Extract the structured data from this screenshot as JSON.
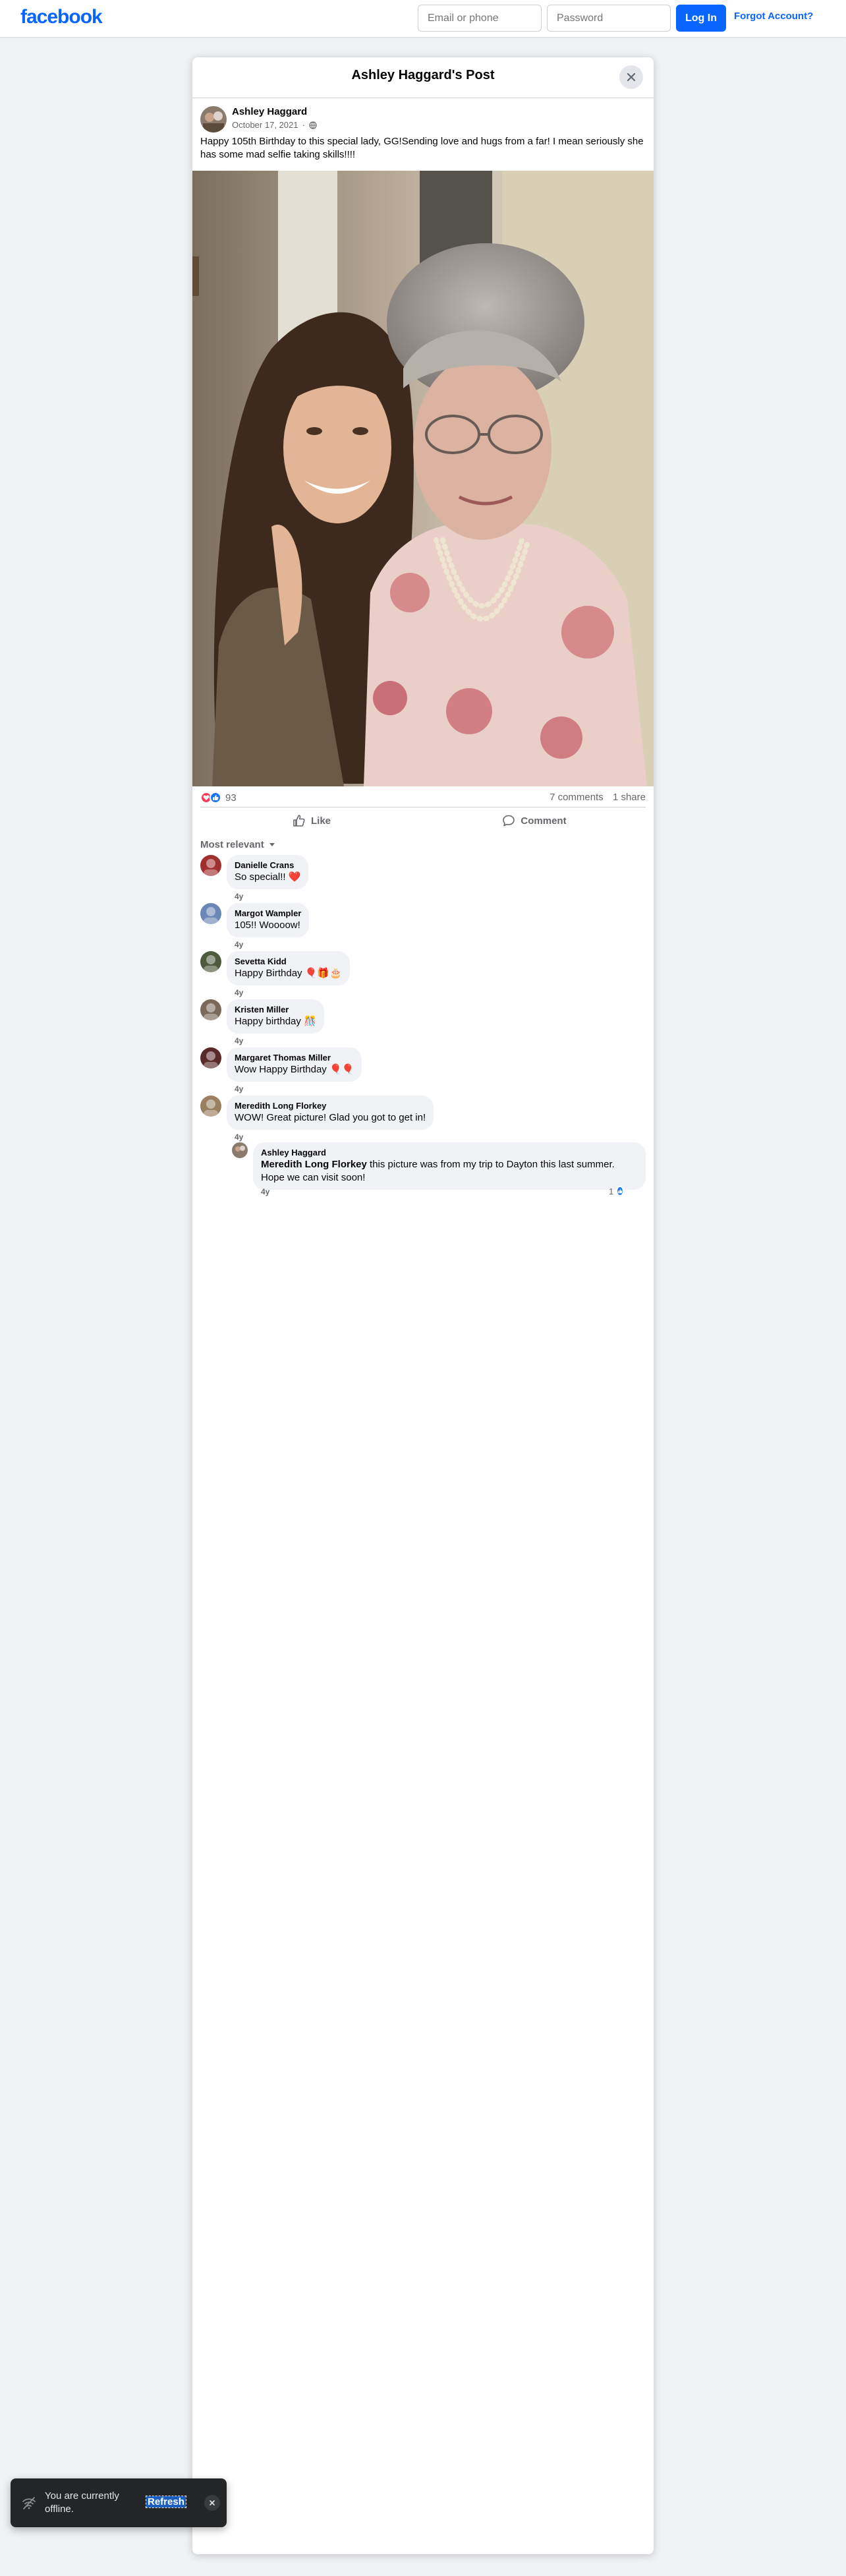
{
  "header": {
    "logo": "facebook",
    "email_placeholder": "Email or phone",
    "password_placeholder": "Password",
    "login_label": "Log In",
    "forgot_label": "Forgot Account?"
  },
  "modal": {
    "title": "Ashley Haggard's Post"
  },
  "post": {
    "author": "Ashley Haggard",
    "date": "October 17, 2021",
    "privacy_icon": "globe-icon",
    "text": "Happy 105th Birthday to this special lady, GG!Sending love and hugs from a far! I mean seriously she has some mad selfie taking skills!!!!",
    "reaction_count": "93",
    "comments_count": "7 comments",
    "shares_count": "1 share",
    "like_label": "Like",
    "comment_label": "Comment",
    "sort_label": "Most relevant"
  },
  "comments": [
    {
      "name": "Danielle Crans",
      "text": "So special!! ❤️",
      "time": "4y",
      "color": "#a0302f"
    },
    {
      "name": "Margot Wampler",
      "text": "105!! Woooow!",
      "time": "4y",
      "color": "#6a87b5"
    },
    {
      "name": "Sevetta Kidd",
      "text": "Happy Birthday 🎈🎁🎂",
      "time": "4y",
      "color": "#4e5a3c"
    },
    {
      "name": "Kristen Miller",
      "text": "Happy birthday 🎊",
      "time": "4y",
      "color": "#7b6a5a"
    },
    {
      "name": "Margaret Thomas Miller",
      "text": "Wow Happy Birthday 🎈🎈",
      "time": "4y",
      "color": "#5a2a2a"
    },
    {
      "name": "Meredith Long Florkey",
      "text": "WOW! Great picture! Glad you got to get in!",
      "time": "4y",
      "color": "#9a8060"
    }
  ],
  "reply": {
    "name": "Ashley Haggard",
    "mention": "Meredith Long Florkey",
    "text": " this picture was from my trip to Dayton this last summer. Hope we can visit soon!",
    "time": "4y",
    "likes": "1"
  },
  "toast": {
    "text": "You are currently offline.",
    "link": "Refresh"
  }
}
